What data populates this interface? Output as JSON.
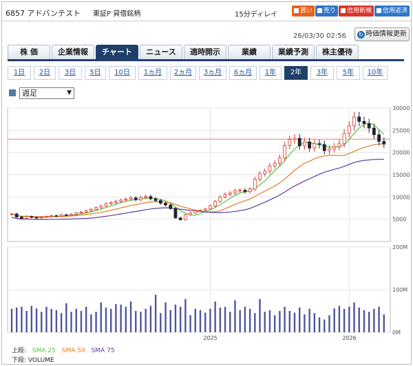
{
  "header": {
    "code_name": "6857 アドバンテスト",
    "market": "東証P 貸借銘柄",
    "delay": "15分ディレイ",
    "buttons": [
      {
        "label": "買い",
        "color": "#e8631c"
      },
      {
        "label": "売り",
        "color": "#2e76c9"
      },
      {
        "label": "信用新規",
        "color": "#d9342b"
      },
      {
        "label": "信用返済",
        "color": "#2e76c9"
      }
    ]
  },
  "timestamp": "26/03/30 02:56",
  "refresh_label": "時価情報更新",
  "tabs": [
    "株 価",
    "企業情報",
    "チャート",
    "ニュース",
    "適時開示",
    "業績",
    "業績予測",
    "株主優待"
  ],
  "active_tab": 2,
  "periods": [
    "1日",
    "2日",
    "3日",
    "5日",
    "10日",
    "1ヵ月",
    "2ヵ月",
    "3ヵ月",
    "6ヵ月",
    "1年",
    "2年",
    "3年",
    "5年",
    "10年"
  ],
  "active_period": 10,
  "interval_select": "週足",
  "chart_data": [
    {
      "type": "line",
      "title": "",
      "y_ticks": [
        "30000",
        "25000",
        "20000",
        "15000",
        "10000",
        "5000"
      ],
      "ylim": [
        0,
        30000
      ],
      "x_ticks": [
        "2025",
        "2026"
      ],
      "horizontal_line": 23000,
      "candles_close_estimate": [
        6200,
        5500,
        5200,
        5600,
        5400,
        5300,
        5500,
        5600,
        5800,
        5700,
        6000,
        5900,
        6100,
        6400,
        6600,
        6900,
        7200,
        7600,
        8000,
        8500,
        8700,
        9000,
        9300,
        9500,
        9800,
        9400,
        9900,
        10100,
        9600,
        9200,
        8600,
        8200,
        7400,
        5300,
        4900,
        6000,
        6400,
        6900,
        7000,
        7300,
        8000,
        9000,
        10000,
        10600,
        10900,
        11400,
        11500,
        11200,
        11800,
        14000,
        15200,
        15800,
        17000,
        17600,
        18800,
        21600,
        22900,
        23200,
        21500,
        22400,
        21000,
        22000,
        21800,
        20400,
        20800,
        21300,
        22000,
        24300,
        26000,
        28000,
        27000,
        26500,
        25500,
        24000,
        22500,
        21900
      ]
    },
    {
      "type": "line",
      "series": [
        {
          "name": "SMA 25",
          "color": "#55c23a"
        },
        {
          "name": "SMA 50",
          "color": "#e47b25"
        },
        {
          "name": "SMA 75",
          "color": "#5c3aa0"
        }
      ]
    },
    {
      "type": "bar",
      "title": "",
      "y_ticks": [
        "200M",
        "100M",
        "0M"
      ],
      "ylim": [
        0,
        200
      ],
      "x_ticks": [
        "2025",
        "2026"
      ],
      "series": [
        {
          "name": "VOLUME",
          "color": "#4c5699"
        }
      ],
      "values": [
        55,
        58,
        60,
        50,
        62,
        56,
        48,
        60,
        55,
        52,
        45,
        68,
        48,
        55,
        50,
        60,
        42,
        48,
        70,
        58,
        55,
        66,
        65,
        60,
        72,
        50,
        48,
        55,
        62,
        88,
        45,
        70,
        52,
        65,
        60,
        78,
        40,
        55,
        52,
        46,
        55,
        72,
        58,
        60,
        48,
        75,
        52,
        60,
        55,
        45,
        78,
        48,
        52,
        40,
        50,
        60,
        50,
        46,
        58,
        42,
        55,
        45,
        35,
        30,
        40,
        56,
        62,
        55,
        60,
        70,
        58,
        52,
        48,
        55,
        60,
        42,
        50,
        45
      ]
    }
  ],
  "legend": {
    "upper_prefix": "上段:",
    "lower_prefix": "下段:",
    "volume_label": "VOLUME"
  }
}
